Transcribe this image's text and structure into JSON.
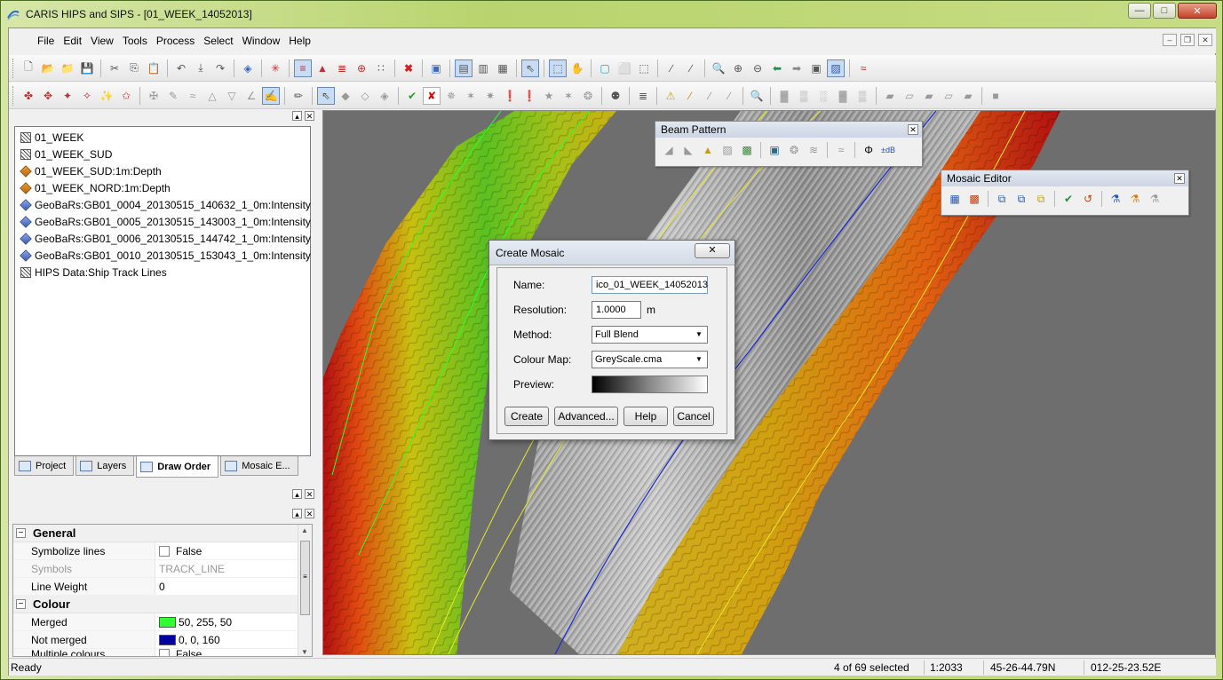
{
  "window": {
    "title": "CARIS HIPS and SIPS - [01_WEEK_14052013]",
    "controls": [
      "minimize",
      "maximize",
      "close"
    ]
  },
  "menu": [
    "File",
    "Edit",
    "View",
    "Tools",
    "Process",
    "Select",
    "Window",
    "Help"
  ],
  "toolbar1": {
    "icons": [
      "new-icon",
      "open-icon",
      "open-folder-icon",
      "save-icon",
      "cut-icon",
      "copy-icon",
      "paste-icon",
      "undo-icon",
      "import-icon",
      "redo-icon",
      "properties-icon",
      "track-icon",
      "profile-icon",
      "sounding-icon",
      "merge-icon",
      "add-icon",
      "grid-icon",
      "delete-icon",
      "layers-icon",
      "window-icon",
      "tile-icon",
      "cascade-icon",
      "cursor-icon",
      "select-icon",
      "pan-icon",
      "box-icon",
      "zoom-icon",
      "zoom-in-icon",
      "zoom-out-icon",
      "back-icon",
      "forward-icon",
      "refresh-icon",
      "display-icon",
      "tide-icon"
    ]
  },
  "toolbar2": {
    "icons": [
      "process1-icon",
      "process2-icon",
      "process3-icon",
      "process4-icon",
      "process5-icon",
      "process6-icon",
      "filter-icon",
      "edit-icon",
      "check-icon",
      "reject-icon",
      "accept-icon",
      "search-icon",
      "binoculars-icon"
    ]
  },
  "project_panel": {
    "layers": [
      {
        "label": "01_WEEK",
        "icon": "hatch"
      },
      {
        "label": "01_WEEK_SUD",
        "icon": "hatch"
      },
      {
        "label": "01_WEEK_SUD:1m:Depth",
        "icon": "depth"
      },
      {
        "label": "01_WEEK_NORD:1m:Depth",
        "icon": "depth"
      },
      {
        "label": "GeoBaRs:GB01_0004_20130515_140632_1_0m:Intensity",
        "icon": "intensity"
      },
      {
        "label": "GeoBaRs:GB01_0005_20130515_143003_1_0m:Intensity",
        "icon": "intensity"
      },
      {
        "label": "GeoBaRs:GB01_0006_20130515_144742_1_0m:Intensity",
        "icon": "intensity"
      },
      {
        "label": "GeoBaRs:GB01_0010_20130515_153043_1_0m:Intensity",
        "icon": "intensity"
      },
      {
        "label": "HIPS Data:Ship Track Lines",
        "icon": "hatch"
      }
    ],
    "tabs": [
      "Project",
      "Layers",
      "Draw Order",
      "Mosaic E..."
    ],
    "active_tab": "Draw Order"
  },
  "properties": {
    "general": "General",
    "symbolize_lines": {
      "name": "Symbolize lines",
      "value": "False"
    },
    "symbols": {
      "name": "Symbols",
      "value": "TRACK_LINE"
    },
    "line_weight": {
      "name": "Line Weight",
      "value": "0"
    },
    "colour": "Colour",
    "merged": {
      "name": "Merged",
      "value": "50, 255, 50",
      "color": "#32ff32"
    },
    "not_merged": {
      "name": "Not merged",
      "value": "0, 0, 160",
      "color": "#0000a0"
    },
    "multiple_colours": {
      "name": "Multiple colours",
      "value": "False"
    }
  },
  "beam_pattern": {
    "title": "Beam Pattern",
    "icons": [
      "bp1-icon",
      "bp2-icon",
      "bp3-icon",
      "bp4-icon",
      "bp5-icon",
      "bp6-icon",
      "bp7-icon",
      "bp8-icon",
      "bp9-icon",
      "phase-icon",
      "db-icon"
    ]
  },
  "mosaic_editor": {
    "title": "Mosaic Editor",
    "icons": [
      "me1-icon",
      "me2-icon",
      "me3-icon",
      "me4-icon",
      "me5-icon",
      "me6-icon",
      "me7-icon",
      "me8-icon",
      "me9-icon",
      "me10-icon"
    ]
  },
  "dialog": {
    "title": "Create Mosaic",
    "name_label": "Name:",
    "name_value": "ico_01_WEEK_14052013",
    "resolution_label": "Resolution:",
    "resolution_value": "1.0000",
    "resolution_unit": "m",
    "method_label": "Method:",
    "method_value": "Full Blend",
    "colour_map_label": "Colour Map:",
    "colour_map_value": "GreyScale.cma",
    "preview_label": "Preview:",
    "buttons": {
      "create": "Create",
      "advanced": "Advanced...",
      "help": "Help",
      "cancel": "Cancel"
    }
  },
  "status": {
    "ready": "Ready",
    "selected": "4 of 69 selected",
    "scale": "1:2033",
    "latitude": "45-26-44.79N",
    "longitude": "012-25-23.52E"
  }
}
